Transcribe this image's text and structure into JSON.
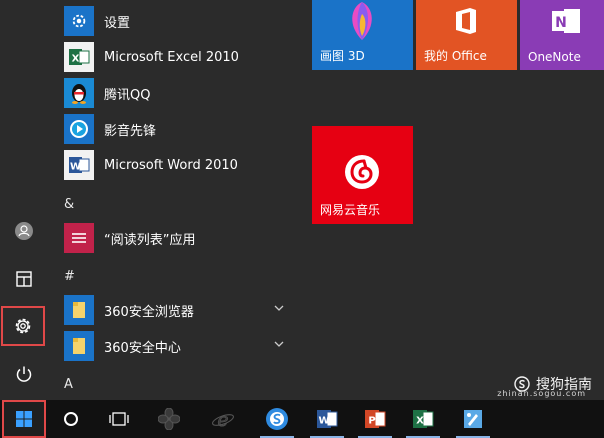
{
  "start_menu": {
    "apps": [
      {
        "label": "设置",
        "icon": "gear-icon",
        "color": "#1a73c8"
      },
      {
        "label": "Microsoft Excel 2010",
        "icon": "excel-icon",
        "color": "#1e7145"
      },
      {
        "label": "腾讯QQ",
        "icon": "qq-penguin-icon",
        "color": "#1a8ad4"
      },
      {
        "label": "影音先锋",
        "icon": "media-player-icon",
        "color": "#1a73c8"
      },
      {
        "label": "Microsoft Word 2010",
        "icon": "word-icon",
        "color": "#2b579a"
      }
    ],
    "group_amp": {
      "header": "&",
      "apps": [
        {
          "label": "“阅读列表”应用",
          "icon": "reading-list-icon",
          "color": "#c1224a"
        }
      ]
    },
    "group_hash": {
      "header": "#",
      "apps": [
        {
          "label": "360安全浏览器",
          "icon": "folder-icon",
          "color": "#1a73c8"
        },
        {
          "label": "360安全中心",
          "icon": "folder-icon",
          "color": "#1a73c8"
        }
      ]
    },
    "group_a": {
      "header": "A"
    }
  },
  "tiles": [
    {
      "label": "画图 3D",
      "icon": "paint-3d-icon",
      "color": "#1a73c8"
    },
    {
      "label": "我的 Office",
      "icon": "office-icon",
      "color": "#e25424"
    },
    {
      "label": "OneNote",
      "icon": "onenote-icon",
      "color": "#8a3cb5"
    },
    {
      "label": "网易云音乐",
      "icon": "netease-music-icon",
      "color": "#e60012"
    }
  ],
  "taskbar": {
    "items": [
      "windows-start-icon",
      "cortana-circle-icon",
      "task-view-icon",
      "fan-app-icon",
      "ie-browser-icon",
      "sogou-browser-icon",
      "word-icon",
      "powerpoint-icon",
      "excel-icon",
      "paint-app-icon"
    ]
  },
  "watermark": {
    "text": "搜狗指南",
    "url": "zhinan.sogou.com"
  }
}
